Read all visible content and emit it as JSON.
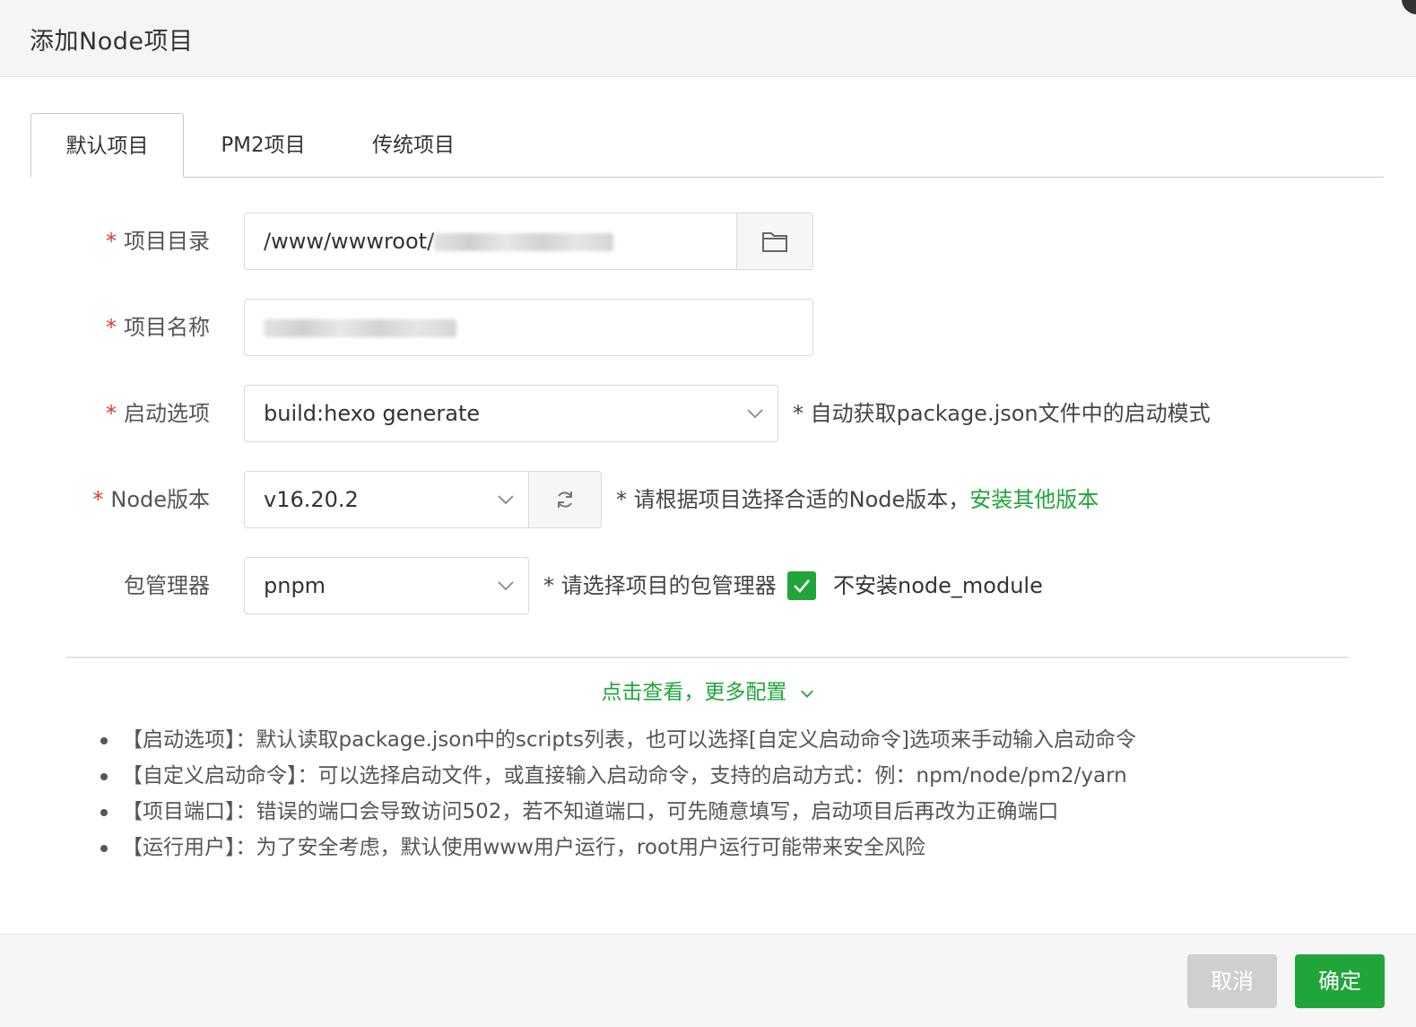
{
  "dialog": {
    "title": "添加Node项目"
  },
  "tabs": [
    {
      "label": "默认项目",
      "active": true
    },
    {
      "label": "PM2项目",
      "active": false
    },
    {
      "label": "传统项目",
      "active": false
    }
  ],
  "form": {
    "project_dir": {
      "required_mark": "*",
      "label": "项目目录",
      "value": "/www/wwwroot/",
      "addon_icon": "folder-icon"
    },
    "project_name": {
      "required_mark": "*",
      "label": "项目名称",
      "value": ""
    },
    "start_option": {
      "required_mark": "*",
      "label": "启动选项",
      "value": "build:hexo generate",
      "hint": "* 自动获取package.json文件中的启动模式"
    },
    "node_version": {
      "required_mark": "*",
      "label": "Node版本",
      "value": "v16.20.2",
      "hint": "* 请根据项目选择合适的Node版本，",
      "link": "安装其他版本",
      "addon_icon": "refresh-icon"
    },
    "package_manager": {
      "label": "包管理器",
      "value": "pnpm",
      "hint": "* 请选择项目的包管理器",
      "checkbox_label": "不安装node_module",
      "checkbox_checked": true
    }
  },
  "more_config": {
    "label": "点击查看，更多配置"
  },
  "notes": [
    "【启动选项】：默认读取package.json中的scripts列表，也可以选择[自定义启动命令]选项来手动输入启动命令",
    "【自定义启动命令】：可以选择启动文件，或直接输入启动命令，支持的启动方式：例：npm/node/pm2/yarn",
    "【项目端口】：错误的端口会导致访问502，若不知道端口，可先随意填写，启动项目后再改为正确端口",
    "【运行用户】：为了安全考虑，默认使用www用户运行，root用户运行可能带来安全风险"
  ],
  "footer": {
    "cancel_label": "取消",
    "ok_label": "确定"
  },
  "colors": {
    "accent": "#20a53a",
    "required": "#e0392c",
    "cancel_bg": "#cfcfcf"
  }
}
